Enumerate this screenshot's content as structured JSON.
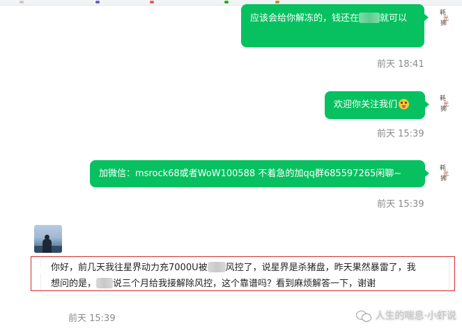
{
  "colors": {
    "outgoing_bubble": "#07c160",
    "outgoing_text": "#ffffff",
    "incoming_bubble": "#ffffff",
    "timestamp": "#8a8a8a",
    "highlight_box": "#d02a2a"
  },
  "messages": [
    {
      "direction": "outgoing",
      "text_before": "应该会给你解冻的，钱还在",
      "text_after": "就可以",
      "timestamp": "前天 18:41"
    },
    {
      "direction": "outgoing",
      "text": "欢迎你关注我们",
      "emoji": "tongue-out-emoji",
      "timestamp": "前天 15:39"
    },
    {
      "direction": "outgoing",
      "text": "加微信：msrock68或者WoW100588 不着急的加qq群685597265闲聊~",
      "timestamp": "前天 15:39"
    },
    {
      "direction": "incoming",
      "line1_before": "你好，前几天我往星界动力充7000U被",
      "line1_after": "风控了，说星界是杀猪盘，昨天果然暴雷了，我",
      "line2_before": "想问的是，",
      "line2_after": "说三个月给我接解除风控，这个靠谱吗？看到麻烦解答一下，谢谢",
      "timestamp": "前天 15:39"
    }
  ],
  "watermark": {
    "icon": "wechat-icon",
    "text": "人生的喘息·小虾说"
  }
}
